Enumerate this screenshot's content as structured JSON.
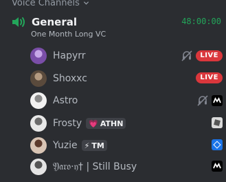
{
  "section": {
    "title": "Voice Channels"
  },
  "channel": {
    "name": "General",
    "timer": "48:00:00",
    "status": "One Month Long VC"
  },
  "live_label": "LIVE",
  "users": [
    {
      "name": "Hapyrr",
      "avatar_colors": [
        "#7a4ea8",
        "#c7a7e8"
      ],
      "deafened": true,
      "live": true
    },
    {
      "name": "Shoxxc",
      "avatar_colors": [
        "#5a4a3c",
        "#b49a80"
      ],
      "deafened": false,
      "live": true
    },
    {
      "name": "Astro",
      "avatar_colors": [
        "#f2f2f2",
        "#8a8a8a"
      ],
      "deafened": true,
      "activity": "game-icon"
    },
    {
      "name": "Frosty",
      "avatar_colors": [
        "#e8e8e8",
        "#6b6b6b"
      ],
      "tag": "ATHN",
      "tag_emoji": "💗",
      "activity": "roblox-icon"
    },
    {
      "name": "Yuzie",
      "avatar_colors": [
        "#d8c4b4",
        "#5c3a2c"
      ],
      "tag": "TM",
      "tag_emoji": "⚡",
      "activity": "blue-app-icon"
    },
    {
      "name": "𝔜𝔞𝔯𝔬·𝔶† | Still Busy",
      "avatar_colors": [
        "#e4e4e4",
        "#555555"
      ],
      "activity": "game-icon"
    }
  ],
  "colors": {
    "background": "#2b2d31",
    "accent_green": "#23a55a",
    "live_red": "#da373c"
  }
}
